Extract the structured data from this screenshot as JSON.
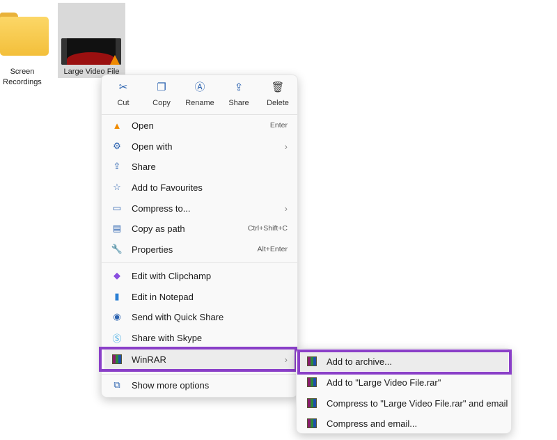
{
  "desktop": {
    "items": [
      {
        "label": "Screen Recordings"
      },
      {
        "label": "Large Video File"
      }
    ]
  },
  "toolbar": [
    {
      "label": "Cut",
      "icon": "cut-icon",
      "glyph": "✂"
    },
    {
      "label": "Copy",
      "icon": "copy-icon",
      "glyph": "❐"
    },
    {
      "label": "Rename",
      "icon": "rename-icon",
      "glyph": "Ⓐ"
    },
    {
      "label": "Share",
      "icon": "share-icon",
      "glyph": "⇪"
    },
    {
      "label": "Delete",
      "icon": "delete-icon",
      "glyph": "🗑"
    }
  ],
  "menu": {
    "group1": [
      {
        "label": "Open",
        "shortcut": "Enter",
        "glyph": "▲"
      },
      {
        "label": "Open with",
        "submenu": true,
        "glyph": "⚙"
      },
      {
        "label": "Share",
        "glyph": "⇪"
      },
      {
        "label": "Add to Favourites",
        "glyph": "☆"
      },
      {
        "label": "Compress to...",
        "submenu": true,
        "glyph": "▭"
      },
      {
        "label": "Copy as path",
        "shortcut": "Ctrl+Shift+C",
        "glyph": "▤"
      },
      {
        "label": "Properties",
        "shortcut": "Alt+Enter",
        "glyph": "🔧"
      }
    ],
    "group2": [
      {
        "label": "Edit with Clipchamp",
        "glyph": "◆"
      },
      {
        "label": "Edit in Notepad",
        "glyph": "▮"
      },
      {
        "label": "Send with Quick Share",
        "glyph": "◉"
      },
      {
        "label": "Share with Skype",
        "glyph": "Ⓢ"
      },
      {
        "label": "WinRAR",
        "submenu": true
      }
    ],
    "show_more": "Show more options"
  },
  "submenu": [
    {
      "label": "Add to archive..."
    },
    {
      "label": "Add to \"Large Video File.rar\""
    },
    {
      "label": "Compress to \"Large Video File.rar\" and email"
    },
    {
      "label": "Compress and email..."
    }
  ],
  "colors": {
    "highlight": "#8a3fc8",
    "icon": "#2c63b0"
  }
}
